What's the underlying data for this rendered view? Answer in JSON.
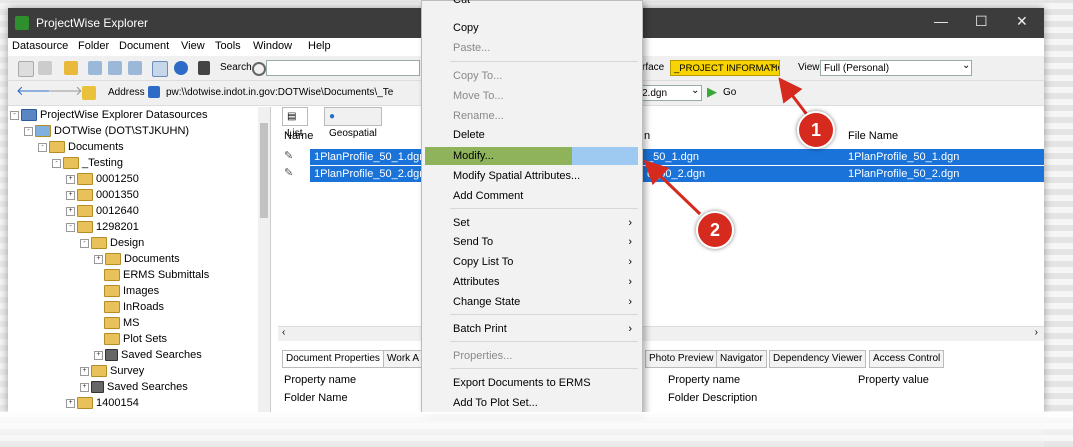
{
  "window": {
    "title": "ProjectWise Explorer",
    "minimize": "—",
    "maximize": "☐",
    "close": "✕"
  },
  "menu": [
    "Datasource",
    "Folder",
    "Document",
    "View",
    "Tools",
    "Window",
    "Help"
  ],
  "toolbar": {
    "search_label": "Search",
    "interface_label": "rface",
    "interface_value": "_PROJECT INFORMATION",
    "view_label": "View",
    "view_value": "Full (Personal)",
    "address_label": "Address",
    "address_value": "pw:\\\\dotwise.indot.in.gov:DOTWise\\Documents\\_Te",
    "address_tail": "2.dgn",
    "go_label": "Go"
  },
  "tree": {
    "root": "ProjectWise Explorer Datasources",
    "datasource": "DOTWise (DOT\\STJKUHN)",
    "items": [
      "Documents",
      "_Testing",
      "0001250",
      "0001350",
      "0012640",
      "1298201",
      "Design",
      "Documents",
      "ERMS Submittals",
      "Images",
      "InRoads",
      "MS",
      "Plot Sets",
      "Saved Searches",
      "Survey",
      "Saved Searches",
      "1400154"
    ]
  },
  "tabs": [
    "List",
    "Geospatial"
  ],
  "columns": {
    "name": "Name",
    "desc": "n",
    "file": "File Name"
  },
  "rows": [
    {
      "name": "1PlanProfile_50_1.dgn",
      "desc": "_50_1.dgn",
      "file": "1PlanProfile_50_1.dgn"
    },
    {
      "name": "1PlanProfile_50_2.dgn",
      "desc": "e_50_2.dgn",
      "file": "1PlanProfile_50_2.dgn"
    }
  ],
  "bottom_tabs_left": [
    "Document Properties",
    "Work A"
  ],
  "bottom_tabs_right": [
    "Photo Preview",
    "Navigator",
    "Dependency Viewer",
    "Access Control"
  ],
  "props": {
    "h1": "Property name",
    "v1": "Folder Name",
    "h2": "Property name",
    "h3": "Property value",
    "v2": "Folder Description"
  },
  "context_menu": [
    {
      "label": "Cut",
      "disabled": false
    },
    {
      "label": "Copy",
      "disabled": false
    },
    {
      "label": "Paste...",
      "disabled": true
    },
    {
      "label": "Copy To...",
      "disabled": true
    },
    {
      "label": "Move To...",
      "disabled": true
    },
    {
      "label": "Rename...",
      "disabled": true
    },
    {
      "label": "Delete",
      "disabled": false
    },
    {
      "label": "Modify...",
      "disabled": false
    },
    {
      "label": "Modify Spatial Attributes...",
      "disabled": false
    },
    {
      "label": "Add Comment",
      "disabled": false
    },
    {
      "label": "Set",
      "disabled": false
    },
    {
      "label": "Send To",
      "disabled": false
    },
    {
      "label": "Copy List To",
      "disabled": false
    },
    {
      "label": "Attributes",
      "disabled": false
    },
    {
      "label": "Change State",
      "disabled": false
    },
    {
      "label": "Batch Print",
      "disabled": false
    },
    {
      "label": "Properties...",
      "disabled": true
    },
    {
      "label": "Export Documents to ERMS",
      "disabled": false
    },
    {
      "label": "Add To Plot Set...",
      "disabled": false
    }
  ],
  "callouts": [
    "1",
    "2"
  ],
  "colors": {
    "selection": "#1a73d9",
    "modify_highlight": "#8fb35a",
    "callout": "#d62a1f"
  }
}
